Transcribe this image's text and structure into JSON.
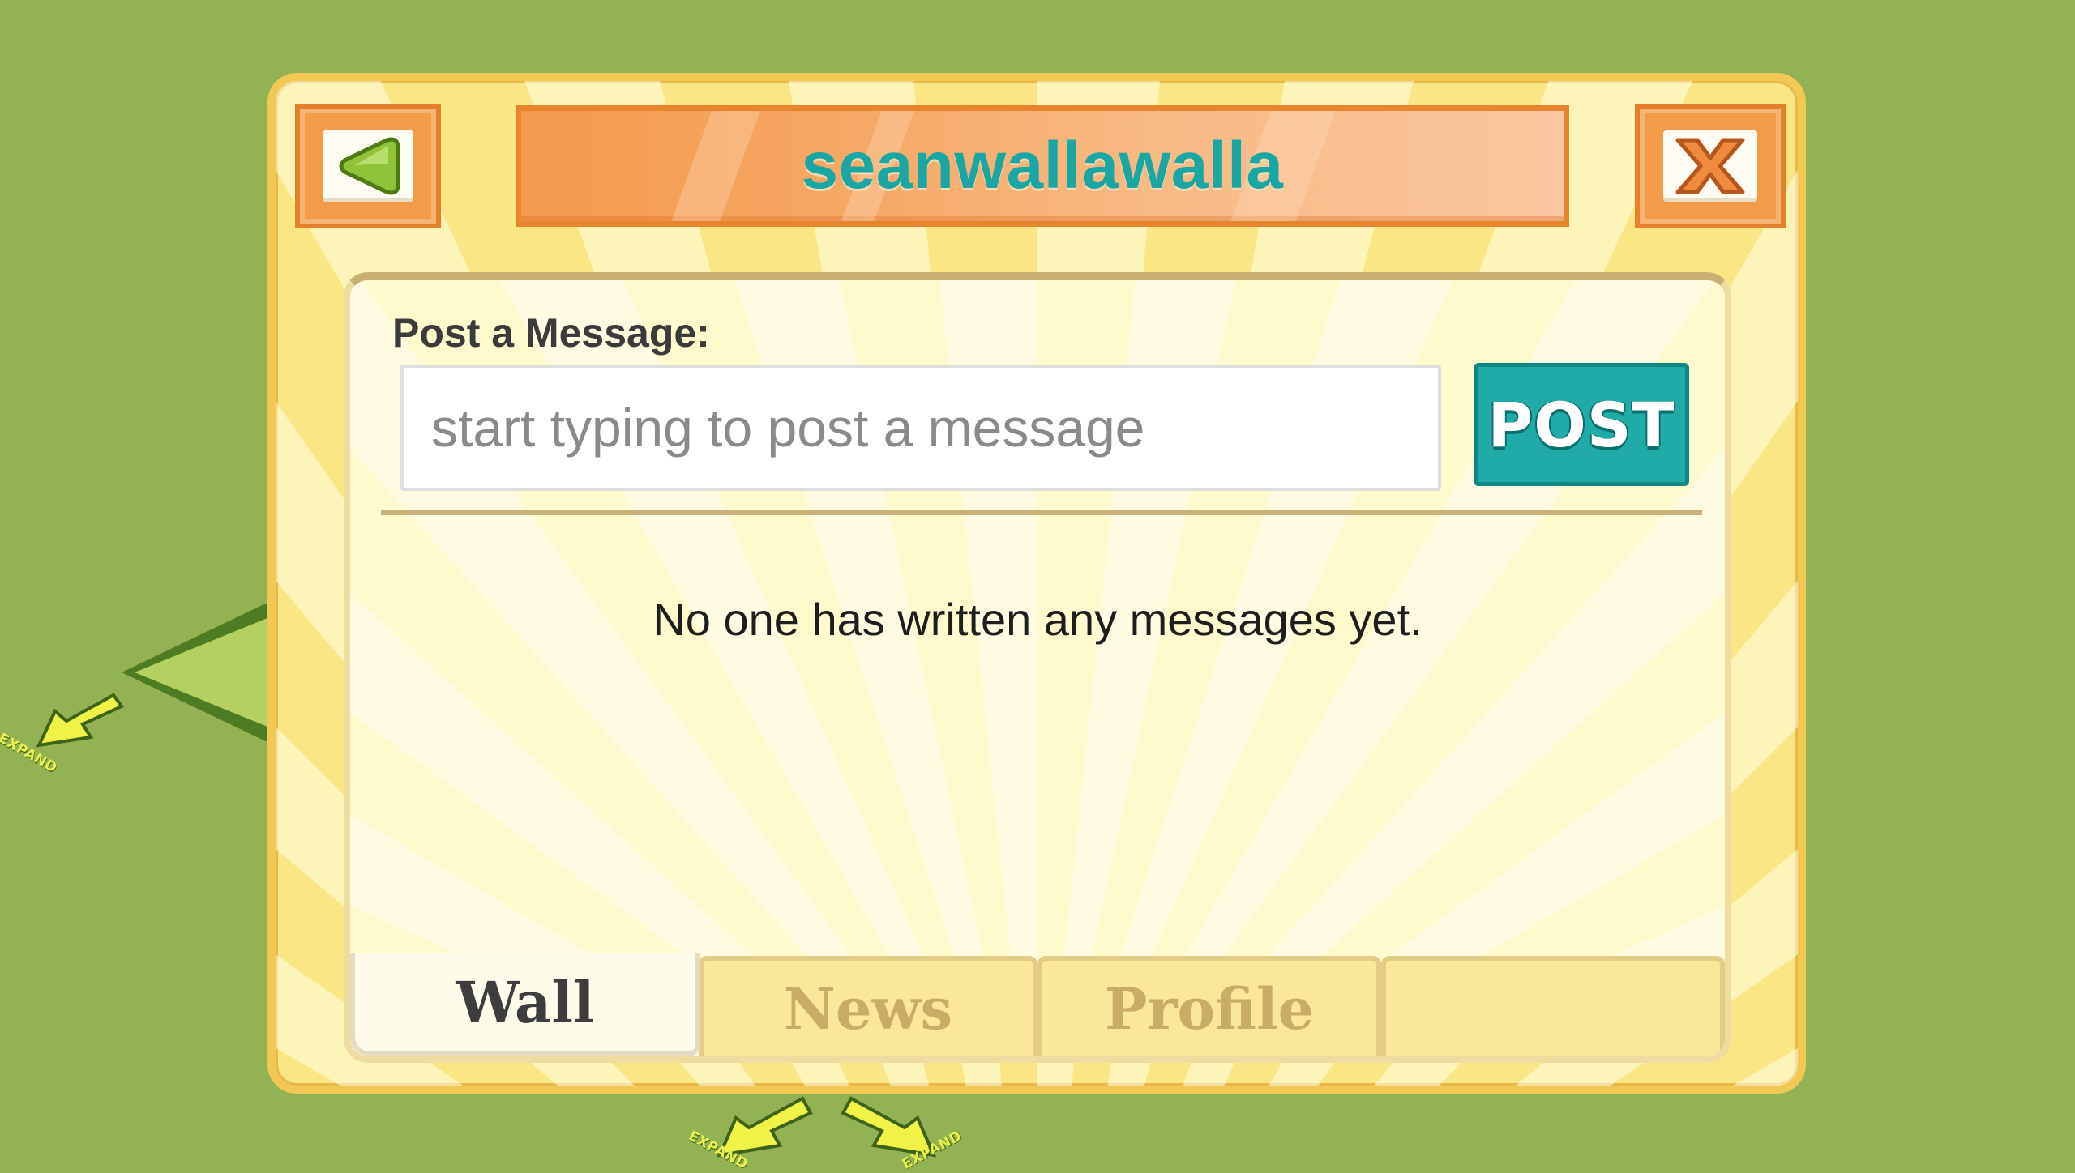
{
  "window": {
    "title": "seanwallawalla"
  },
  "header": {
    "back_icon": "back-arrow-icon",
    "close_icon": "close-x-icon",
    "accent_color": "#1aa7a4"
  },
  "post": {
    "label": "Post a Message:",
    "placeholder": "start typing to post a message",
    "value": "",
    "button_label": "POST"
  },
  "wall": {
    "empty_message": "No one has written any messages yet."
  },
  "tabs": [
    {
      "label": "Wall",
      "active": true
    },
    {
      "label": "News",
      "active": false
    },
    {
      "label": "Profile",
      "active": false
    },
    {
      "label": "",
      "active": false
    }
  ],
  "map": {
    "expand_label": "EXPAND"
  }
}
